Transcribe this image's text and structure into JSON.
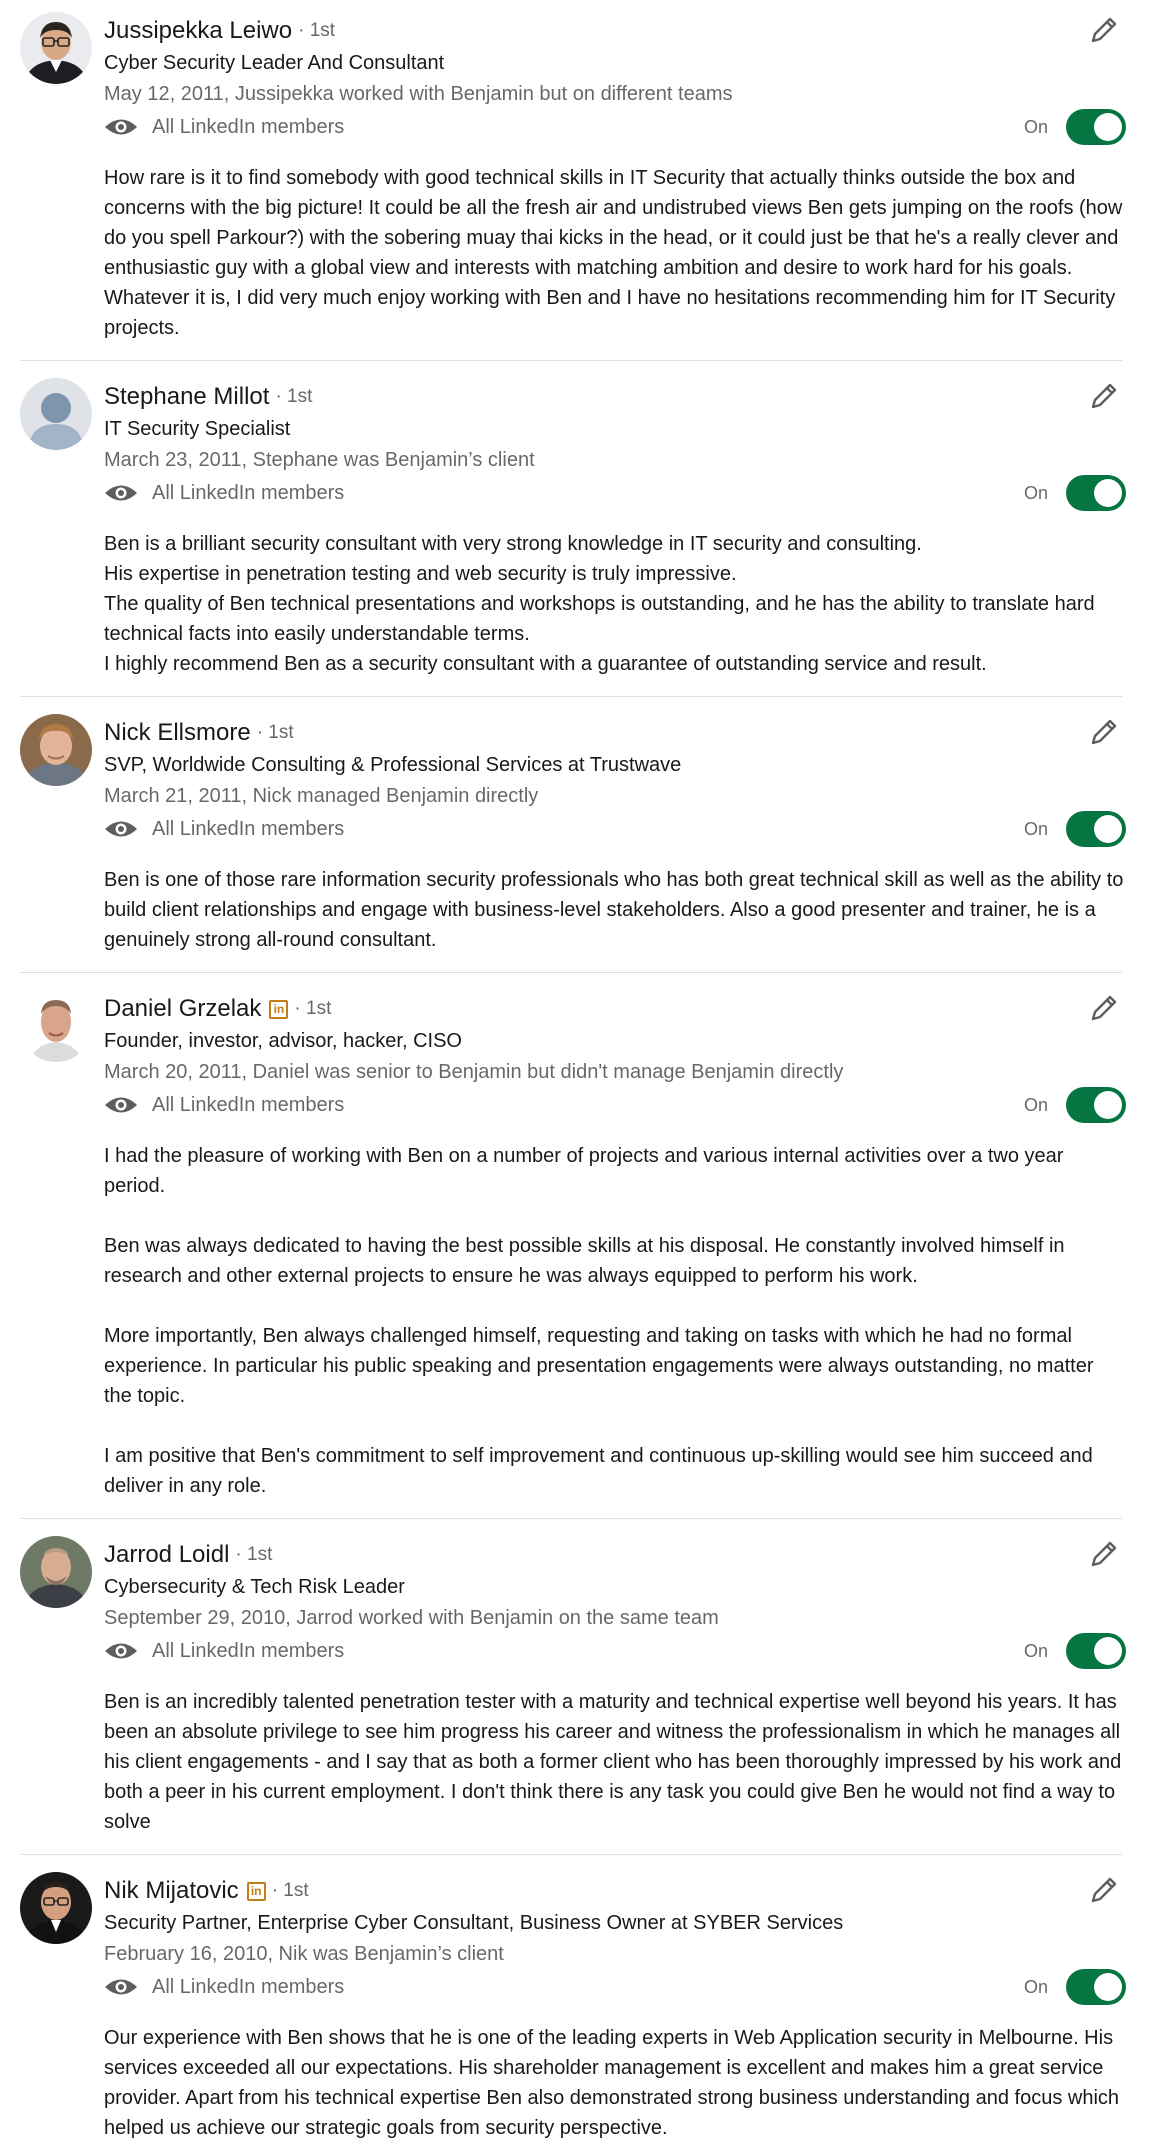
{
  "recommendations": [
    {
      "name": "Jussipekka Leiwo",
      "degree": "· 1st",
      "headline": "Cyber Security Leader And Consultant",
      "relationship": "May 12, 2011, Jussipekka worked with Benjamin but on different teams",
      "visibility": "All LinkedIn members",
      "toggle_label": "On",
      "toggle_state": "on",
      "icon": "person-photo",
      "body": "How rare is it to find somebody with good technical skills in IT Security that actually thinks outside the box and concerns with the big picture! It could be all the fresh air and undistrubed views Ben gets jumping on the roofs (how do you spell Parkour?) with the sobering muay thai kicks in the head, or it could just be that he's a really clever and enthusiastic guy with a global view and interests with matching ambition and desire to work hard for his goals. Whatever it is, I did very much enjoy working with Ben and I have no hesitations recommending him for IT Security projects."
    },
    {
      "name": "Stephane Millot",
      "degree": "· 1st",
      "headline": "IT Security Specialist",
      "relationship": "March 23, 2011, Stephane was Benjamin’s client",
      "visibility": "All LinkedIn members",
      "toggle_label": "On",
      "toggle_state": "on",
      "icon": "default-avatar",
      "body": "Ben is a brilliant security consultant with very strong knowledge in IT security and consulting.\nHis expertise in penetration testing and web security is truly impressive.\nThe quality of Ben technical presentations and workshops is outstanding, and he has the ability to translate hard technical facts into easily understandable terms.\nI highly recommend Ben as a security consultant with a guarantee of outstanding service and result."
    },
    {
      "name": "Nick Ellsmore",
      "degree": "· 1st",
      "headline": "SVP, Worldwide Consulting & Professional Services at Trustwave",
      "relationship": "March 21, 2011, Nick managed Benjamin directly",
      "visibility": "All LinkedIn members",
      "toggle_label": "On",
      "toggle_state": "on",
      "icon": "person-photo",
      "body": "Ben is one of those rare information security professionals who has both great technical skill as well as the ability to build client relationships and engage with business-level stakeholders. Also a good presenter and trainer, he is a genuinely strong all-round consultant."
    },
    {
      "name": "Daniel Grzelak",
      "degree": "· 1st",
      "premium": true,
      "headline": "Founder, investor, advisor, hacker, CISO",
      "relationship": "March 20, 2011, Daniel was senior to Benjamin but didn't manage Benjamin directly",
      "visibility": "All LinkedIn members",
      "toggle_label": "On",
      "toggle_state": "on",
      "icon": "person-photo",
      "body": "I had the pleasure of working with Ben on a number of projects and various internal activities over a two year period.\n\nBen was always dedicated to having the best possible skills at his disposal. He constantly involved himself in research and other external projects to ensure he was always equipped to perform his work.\n\nMore importantly, Ben always challenged himself, requesting and taking on tasks with which he had no formal experience. In particular his public speaking and presentation engagements were always outstanding, no matter the topic.\n\nI am positive that Ben's commitment to self improvement and continuous up-skilling would see him succeed and deliver in any role."
    },
    {
      "name": "Jarrod Loidl",
      "degree": "· 1st",
      "headline": "Cybersecurity & Tech Risk Leader",
      "relationship": "September 29, 2010, Jarrod worked with Benjamin on the same team",
      "visibility": "All LinkedIn members",
      "toggle_label": "On",
      "toggle_state": "on",
      "icon": "person-photo",
      "body": "Ben is an incredibly talented penetration tester with a maturity and technical expertise well beyond his years. It has been an absolute privilege to see him progress his career and witness the professionalism in which he manages all his client engagements - and I say that as both a former client who has been thoroughly impressed by his work and both a peer in his current employment. I don't think there is any task you could give Ben he would not find a way to solve"
    },
    {
      "name": "Nik Mijatovic",
      "degree": "· 1st",
      "premium": true,
      "headline": "Security Partner, Enterprise Cyber Consultant, Business Owner at SYBER Services",
      "relationship": "February 16, 2010, Nik was Benjamin’s client",
      "visibility": "All LinkedIn members",
      "toggle_label": "On",
      "toggle_state": "on",
      "icon": "person-photo",
      "body": "Our experience with Ben shows that he is one of the leading experts in Web Application security in Melbourne. His services exceeded all our expectations. His shareholder management is excellent and makes him a great service provider. Apart from his technical expertise Ben also demonstrated strong business understanding and focus which helped us achieve our strategic goals from security perspective."
    }
  ],
  "colors": {
    "toggle_on": "#057642",
    "premium_badge": "#c37d16",
    "divider": "#e0dfdc"
  }
}
